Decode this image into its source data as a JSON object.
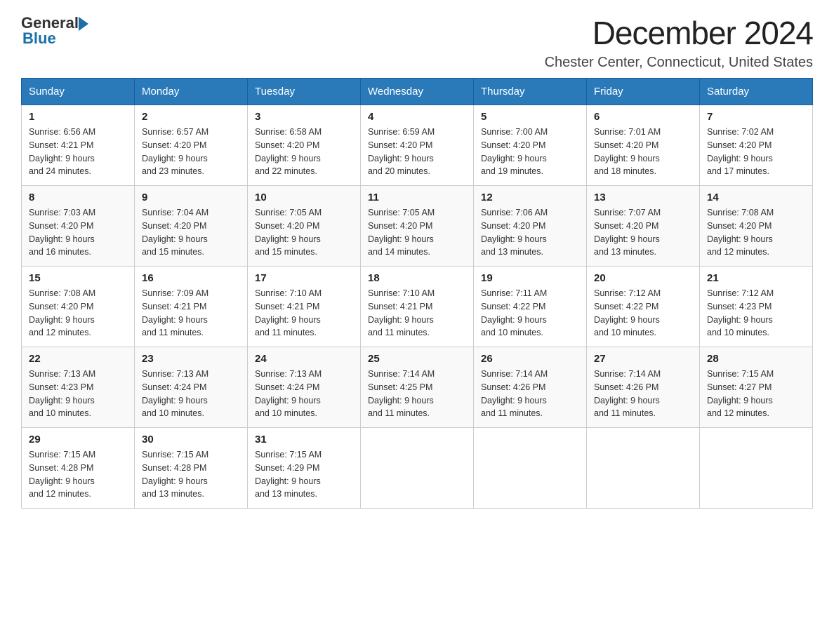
{
  "header": {
    "logo_general": "General",
    "logo_blue": "Blue",
    "month_title": "December 2024",
    "location": "Chester Center, Connecticut, United States"
  },
  "days_of_week": [
    "Sunday",
    "Monday",
    "Tuesday",
    "Wednesday",
    "Thursday",
    "Friday",
    "Saturday"
  ],
  "weeks": [
    [
      {
        "day": "1",
        "sunrise": "6:56 AM",
        "sunset": "4:21 PM",
        "daylight": "9 hours and 24 minutes."
      },
      {
        "day": "2",
        "sunrise": "6:57 AM",
        "sunset": "4:20 PM",
        "daylight": "9 hours and 23 minutes."
      },
      {
        "day": "3",
        "sunrise": "6:58 AM",
        "sunset": "4:20 PM",
        "daylight": "9 hours and 22 minutes."
      },
      {
        "day": "4",
        "sunrise": "6:59 AM",
        "sunset": "4:20 PM",
        "daylight": "9 hours and 20 minutes."
      },
      {
        "day": "5",
        "sunrise": "7:00 AM",
        "sunset": "4:20 PM",
        "daylight": "9 hours and 19 minutes."
      },
      {
        "day": "6",
        "sunrise": "7:01 AM",
        "sunset": "4:20 PM",
        "daylight": "9 hours and 18 minutes."
      },
      {
        "day": "7",
        "sunrise": "7:02 AM",
        "sunset": "4:20 PM",
        "daylight": "9 hours and 17 minutes."
      }
    ],
    [
      {
        "day": "8",
        "sunrise": "7:03 AM",
        "sunset": "4:20 PM",
        "daylight": "9 hours and 16 minutes."
      },
      {
        "day": "9",
        "sunrise": "7:04 AM",
        "sunset": "4:20 PM",
        "daylight": "9 hours and 15 minutes."
      },
      {
        "day": "10",
        "sunrise": "7:05 AM",
        "sunset": "4:20 PM",
        "daylight": "9 hours and 15 minutes."
      },
      {
        "day": "11",
        "sunrise": "7:05 AM",
        "sunset": "4:20 PM",
        "daylight": "9 hours and 14 minutes."
      },
      {
        "day": "12",
        "sunrise": "7:06 AM",
        "sunset": "4:20 PM",
        "daylight": "9 hours and 13 minutes."
      },
      {
        "day": "13",
        "sunrise": "7:07 AM",
        "sunset": "4:20 PM",
        "daylight": "9 hours and 13 minutes."
      },
      {
        "day": "14",
        "sunrise": "7:08 AM",
        "sunset": "4:20 PM",
        "daylight": "9 hours and 12 minutes."
      }
    ],
    [
      {
        "day": "15",
        "sunrise": "7:08 AM",
        "sunset": "4:20 PM",
        "daylight": "9 hours and 12 minutes."
      },
      {
        "day": "16",
        "sunrise": "7:09 AM",
        "sunset": "4:21 PM",
        "daylight": "9 hours and 11 minutes."
      },
      {
        "day": "17",
        "sunrise": "7:10 AM",
        "sunset": "4:21 PM",
        "daylight": "9 hours and 11 minutes."
      },
      {
        "day": "18",
        "sunrise": "7:10 AM",
        "sunset": "4:21 PM",
        "daylight": "9 hours and 11 minutes."
      },
      {
        "day": "19",
        "sunrise": "7:11 AM",
        "sunset": "4:22 PM",
        "daylight": "9 hours and 10 minutes."
      },
      {
        "day": "20",
        "sunrise": "7:12 AM",
        "sunset": "4:22 PM",
        "daylight": "9 hours and 10 minutes."
      },
      {
        "day": "21",
        "sunrise": "7:12 AM",
        "sunset": "4:23 PM",
        "daylight": "9 hours and 10 minutes."
      }
    ],
    [
      {
        "day": "22",
        "sunrise": "7:13 AM",
        "sunset": "4:23 PM",
        "daylight": "9 hours and 10 minutes."
      },
      {
        "day": "23",
        "sunrise": "7:13 AM",
        "sunset": "4:24 PM",
        "daylight": "9 hours and 10 minutes."
      },
      {
        "day": "24",
        "sunrise": "7:13 AM",
        "sunset": "4:24 PM",
        "daylight": "9 hours and 10 minutes."
      },
      {
        "day": "25",
        "sunrise": "7:14 AM",
        "sunset": "4:25 PM",
        "daylight": "9 hours and 11 minutes."
      },
      {
        "day": "26",
        "sunrise": "7:14 AM",
        "sunset": "4:26 PM",
        "daylight": "9 hours and 11 minutes."
      },
      {
        "day": "27",
        "sunrise": "7:14 AM",
        "sunset": "4:26 PM",
        "daylight": "9 hours and 11 minutes."
      },
      {
        "day": "28",
        "sunrise": "7:15 AM",
        "sunset": "4:27 PM",
        "daylight": "9 hours and 12 minutes."
      }
    ],
    [
      {
        "day": "29",
        "sunrise": "7:15 AM",
        "sunset": "4:28 PM",
        "daylight": "9 hours and 12 minutes."
      },
      {
        "day": "30",
        "sunrise": "7:15 AM",
        "sunset": "4:28 PM",
        "daylight": "9 hours and 13 minutes."
      },
      {
        "day": "31",
        "sunrise": "7:15 AM",
        "sunset": "4:29 PM",
        "daylight": "9 hours and 13 minutes."
      },
      null,
      null,
      null,
      null
    ]
  ],
  "labels": {
    "sunrise": "Sunrise:",
    "sunset": "Sunset:",
    "daylight": "Daylight:"
  }
}
